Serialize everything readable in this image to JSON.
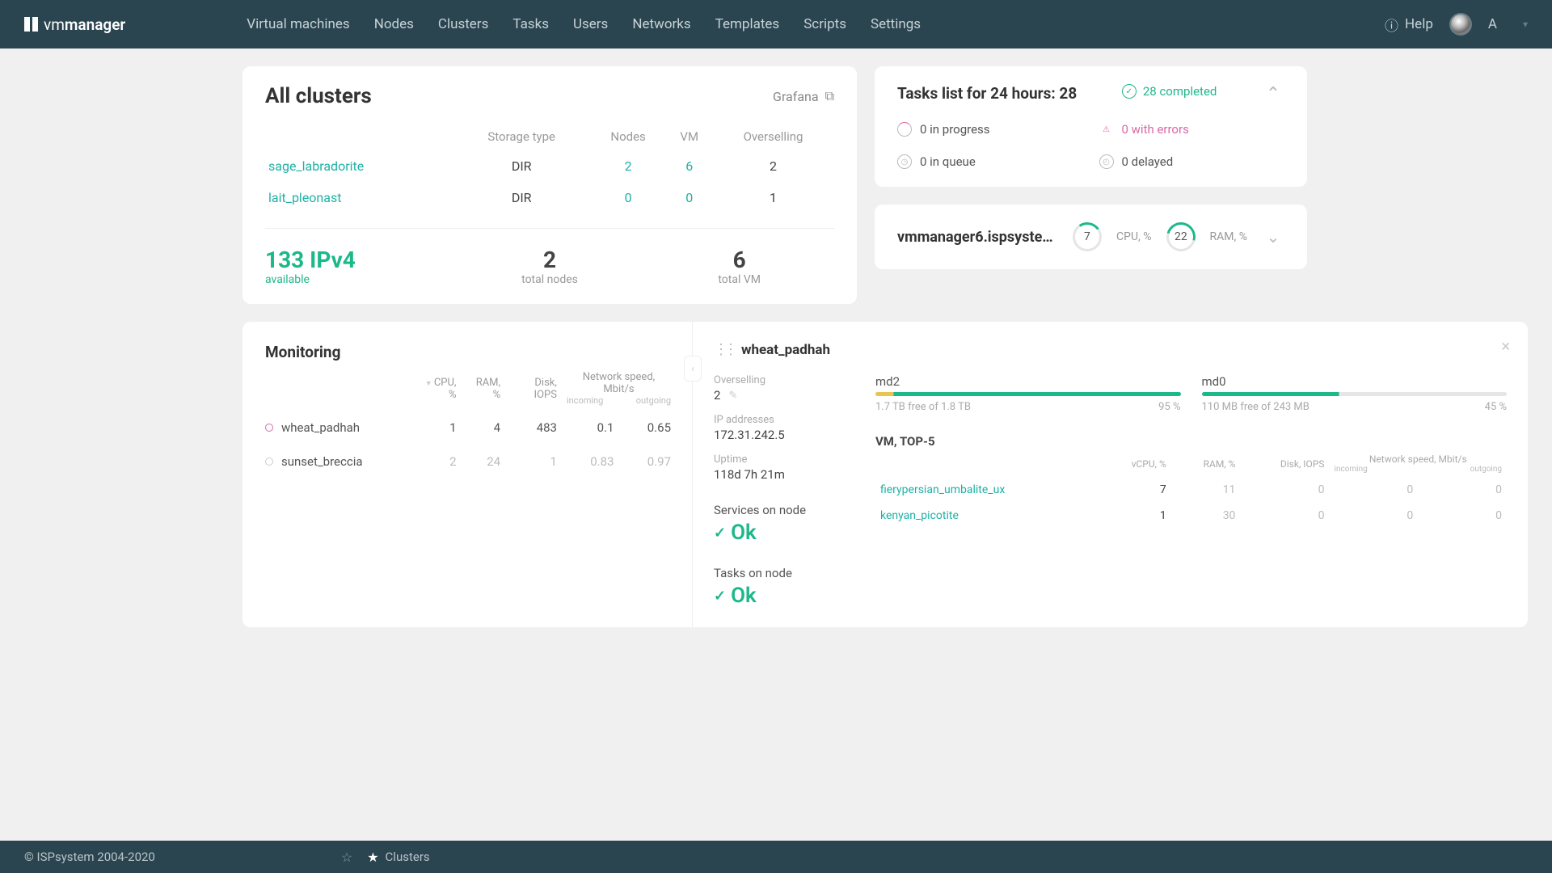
{
  "brand": {
    "prefix": "vm",
    "suffix": "manager"
  },
  "nav": [
    "Virtual machines",
    "Nodes",
    "Clusters",
    "Tasks",
    "Users",
    "Networks",
    "Templates",
    "Scripts",
    "Settings"
  ],
  "help": "Help",
  "user": "A",
  "clusters": {
    "title": "All clusters",
    "grafana": "Grafana",
    "cols": [
      "Storage type",
      "Nodes",
      "VM",
      "Overselling"
    ],
    "rows": [
      {
        "name": "sage_labradorite",
        "storage": "DIR",
        "nodes": "2",
        "vm": "6",
        "over": "2"
      },
      {
        "name": "lait_pleonast",
        "storage": "DIR",
        "nodes": "0",
        "vm": "0",
        "over": "1"
      }
    ],
    "stats": {
      "ipv4": "133 IPv4",
      "ipv4_sub": "available",
      "nodes": "2",
      "nodes_sub": "total nodes",
      "vm": "6",
      "vm_sub": "total VM"
    }
  },
  "tasks": {
    "title": "Tasks list for 24 hours: 28",
    "completed": "28 completed",
    "items": {
      "progress": "0 in progress",
      "errors": "0 with errors",
      "queue": "0 in queue",
      "delayed": "0 delayed"
    }
  },
  "server": {
    "name": "vmmanager6.ispsystem…",
    "cpu": "7",
    "cpu_lbl": "CPU, %",
    "ram": "22",
    "ram_lbl": "RAM, %"
  },
  "monitoring": {
    "title": "Monitoring",
    "cols": {
      "cpu": "CPU, %",
      "ram": "RAM, %",
      "disk": "Disk, IOPS",
      "net": "Network speed, Mbit/s",
      "inc": "incoming",
      "out": "outgoing"
    },
    "rows": [
      {
        "name": "wheat_padhah",
        "cpu": "1",
        "ram": "4",
        "disk": "483",
        "in": "0.1",
        "out": "0.65",
        "active": true
      },
      {
        "name": "sunset_breccia",
        "cpu": "2",
        "ram": "24",
        "disk": "1",
        "in": "0.83",
        "out": "0.97",
        "active": false
      }
    ]
  },
  "detail": {
    "name": "wheat_padhah",
    "over_lbl": "Overselling",
    "over_val": "2",
    "ip_lbl": "IP addresses",
    "ip_val": "172.31.242.5",
    "up_lbl": "Uptime",
    "up_val": "118d 7h 21m",
    "disks": [
      {
        "name": "md2",
        "free": "1.7 TB free of 1.8 TB",
        "pct": "95 %",
        "cls": "p95"
      },
      {
        "name": "md0",
        "free": "110 MB free of 243 MB",
        "pct": "45 %",
        "cls": "p45"
      }
    ],
    "services_lbl": "Services on node",
    "services_ok": "Ok",
    "tasks_lbl": "Tasks on node",
    "tasks_ok": "Ok",
    "vmtop": {
      "title": "VM, TOP-5",
      "cols": {
        "vcpu": "vCPU, %",
        "ram": "RAM, %",
        "disk": "Disk, IOPS",
        "net": "Network speed, Mbit/s",
        "inc": "incoming",
        "out": "outgoing"
      },
      "rows": [
        {
          "name": "fierypersian_umbalite_ux",
          "vcpu": "7",
          "ram": "11",
          "disk": "0",
          "in": "0",
          "out": "0"
        },
        {
          "name": "kenyan_picotite",
          "vcpu": "1",
          "ram": "30",
          "disk": "0",
          "in": "0",
          "out": "0"
        }
      ]
    }
  },
  "footer": {
    "copyright": "© ISPsystem 2004-2020",
    "tab": "Clusters"
  }
}
